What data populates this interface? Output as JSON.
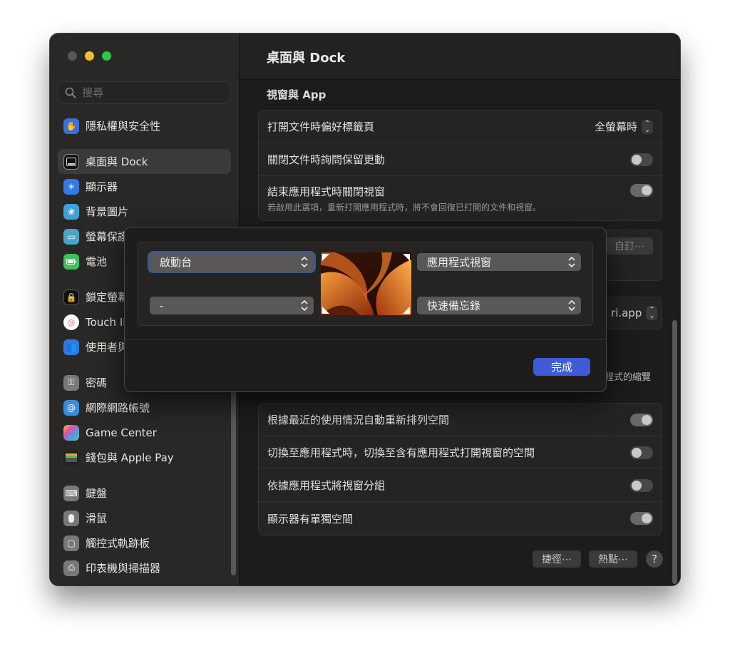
{
  "window": {
    "title": "桌面與 Dock"
  },
  "sidebar": {
    "search_placeholder": "搜尋",
    "items": [
      {
        "label": "隱私權與安全性",
        "icon": "hand-icon",
        "color": "#3a6fe0"
      },
      {
        "label": "桌面與 Dock",
        "icon": "dock-icon",
        "color": "#1a1a1a",
        "active": true
      },
      {
        "label": "顯示器",
        "icon": "sun-icon",
        "color": "#2f7ae5"
      },
      {
        "label": "背景圖片",
        "icon": "flower-icon",
        "color": "#3ba3d9"
      },
      {
        "label": "螢幕保護",
        "icon": "screensaver-icon",
        "color": "#48a6c9"
      },
      {
        "label": "電池",
        "icon": "battery-icon",
        "color": "#3ec25a"
      },
      {
        "label": "鎖定螢幕",
        "icon": "lock-icon",
        "color": "#1a1a1a"
      },
      {
        "label": "Touch ID",
        "icon": "fingerprint-icon",
        "color": "#e85f6b"
      },
      {
        "label": "使用者與群組",
        "icon": "users-icon",
        "color": "#2f7ae5"
      },
      {
        "label": "密碼",
        "icon": "key-icon",
        "color": "#7a7876"
      },
      {
        "label": "網際網路帳號",
        "icon": "at-icon",
        "color": "#3a8be0"
      },
      {
        "label": "Game Center",
        "icon": "game-center-icon",
        "color": "#d96aa8"
      },
      {
        "label": "錢包與 Apple Pay",
        "icon": "wallet-icon",
        "color": "#222"
      },
      {
        "label": "鍵盤",
        "icon": "keyboard-icon",
        "color": "#7a7876"
      },
      {
        "label": "滑鼠",
        "icon": "mouse-icon",
        "color": "#7a7876"
      },
      {
        "label": "觸控式軌跡板",
        "icon": "trackpad-icon",
        "color": "#7a7876"
      },
      {
        "label": "印表機與掃描器",
        "icon": "printer-icon",
        "color": "#7a7876"
      }
    ]
  },
  "main": {
    "section_windows_apps": "視窗與 App",
    "pref_tabs_label": "打開文件時偏好標籤頁",
    "pref_tabs_value": "全螢幕時",
    "ask_keep_label": "關閉文件時詢問保留更動",
    "close_windows_label": "結束應用程式時關閉視窗",
    "close_windows_sub": "若啟用此選項，重新打開應用程式時，將不會回復已打開的文件和視窗。",
    "customize_button": "自訂⋯",
    "browser_value_partial": "ri.app",
    "partial_text": "程式的縮覽",
    "mc_rows": [
      "根據最近的使用情況自動重新排列空間",
      "切換至應用程式時，切換至含有應用程式打開視窗的空間",
      "依據應用程式將視窗分組",
      "顯示器有單獨空間"
    ],
    "shortcuts_button": "捷徑⋯",
    "hot_corners_button": "熱點⋯",
    "help_label": "?"
  },
  "sheet": {
    "top_left": "啟動台",
    "top_right": "應用程式視窗",
    "bottom_left": "-",
    "bottom_right": "快速備忘錄",
    "done": "完成"
  },
  "toggles": {
    "ask_keep": false,
    "close_windows": true,
    "mc_0": true,
    "mc_1": false,
    "mc_2": false,
    "mc_3": true
  }
}
